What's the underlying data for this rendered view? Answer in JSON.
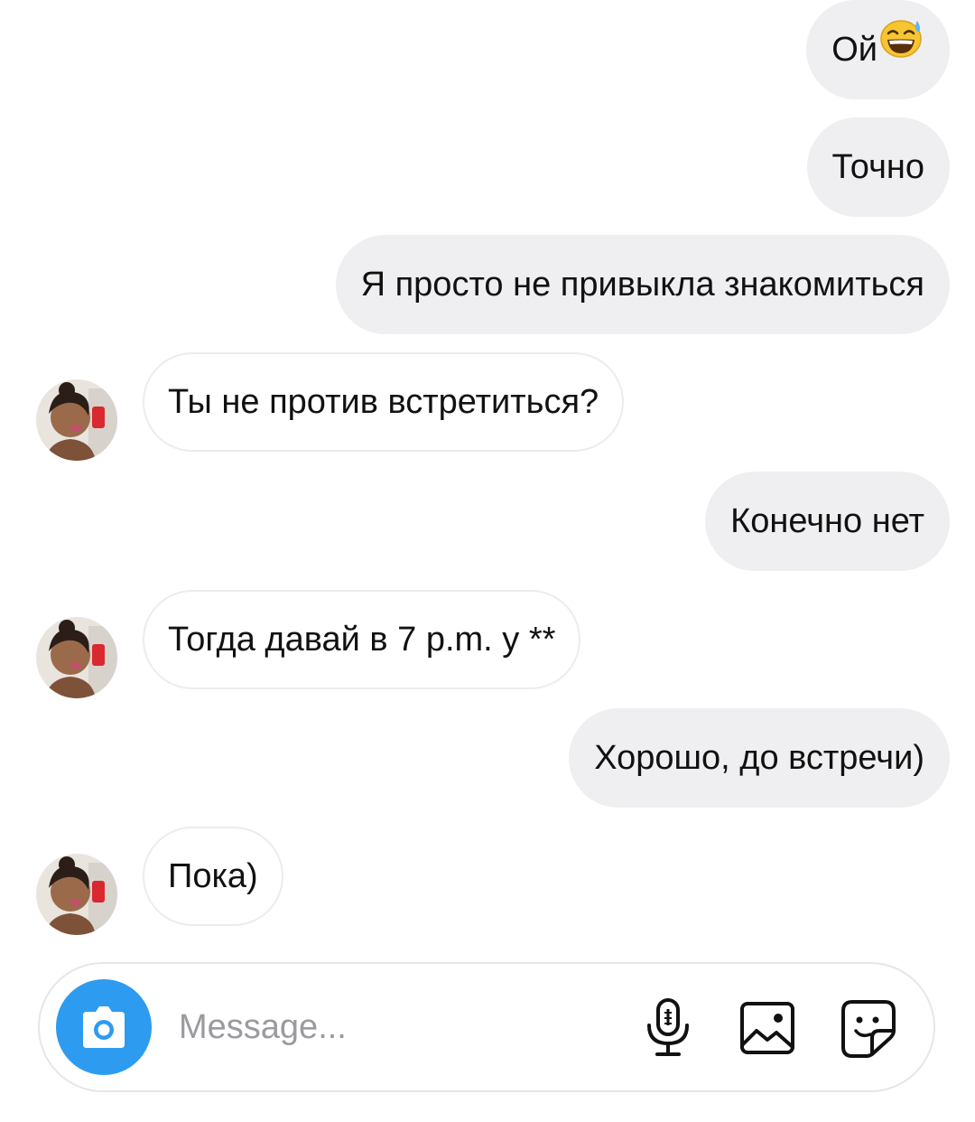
{
  "messages": [
    {
      "side": "out",
      "text": "Ой",
      "emoji": "grinning-sweat-emoji"
    },
    {
      "side": "out",
      "text": "Точно"
    },
    {
      "side": "out",
      "text": "Я просто не привыкла знакомиться"
    },
    {
      "side": "in",
      "text": "Ты не против встретиться?"
    },
    {
      "side": "out",
      "text": "Конечно нет"
    },
    {
      "side": "in",
      "text": "Тогда давай в 7 p.m. у **"
    },
    {
      "side": "out",
      "text": "Хорошо, до встречи)"
    },
    {
      "side": "in",
      "text": "Пока)"
    }
  ],
  "composer": {
    "placeholder": "Message...",
    "icons": [
      "camera-icon",
      "microphone-icon",
      "gallery-icon",
      "sticker-icon"
    ]
  },
  "colors": {
    "outgoing_bubble": "#efeff1",
    "incoming_border": "#ececef",
    "camera_button": "#2d9bf0",
    "placeholder": "#9a9a9f"
  }
}
